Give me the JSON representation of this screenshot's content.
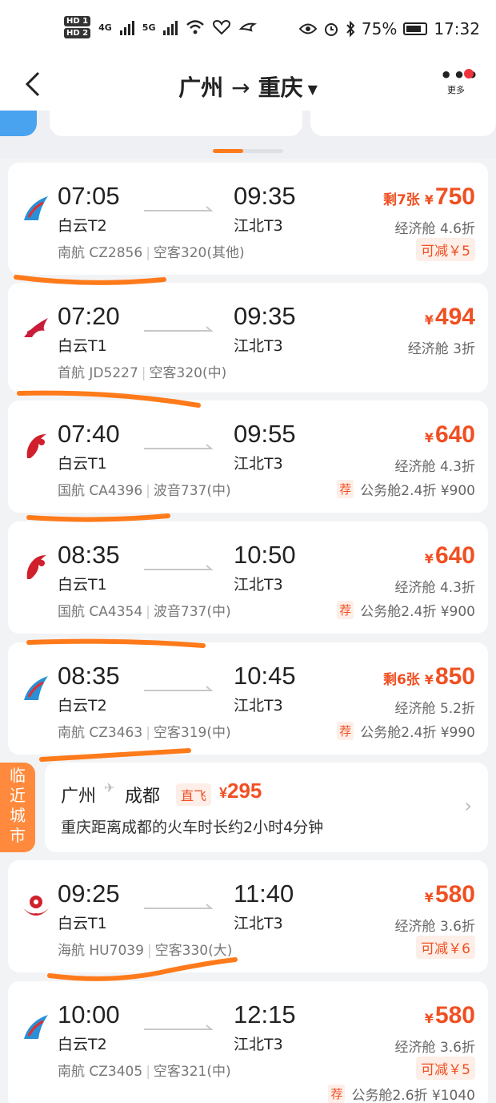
{
  "status_bar": {
    "hd1": "HD 1",
    "hd2": "HD 2",
    "net1": "4G",
    "net2": "5G",
    "battery": "75%",
    "time": "17:32"
  },
  "header": {
    "from": "广州",
    "arrow": "→",
    "to": "重庆",
    "more_label": "更多"
  },
  "flights": [
    {
      "airline_logo": "china-southern-logo",
      "dep_time": "07:05",
      "dep_airport": "白云T2",
      "arr_time": "09:35",
      "arr_airport": "江北T3",
      "airline": "南航 CZ2856",
      "aircraft": "空客320(其他)",
      "left_tickets": "剩7张",
      "currency": "¥",
      "price": "750",
      "cabin": "经济舱 4.6折",
      "discount": "可减￥5",
      "recommend_tag": "",
      "recommend": ""
    },
    {
      "airline_logo": "capital-airlines-logo",
      "dep_time": "07:20",
      "dep_airport": "白云T1",
      "arr_time": "09:35",
      "arr_airport": "江北T3",
      "airline": "首航 JD5227",
      "aircraft": "空客320(中)",
      "left_tickets": "",
      "currency": "¥",
      "price": "494",
      "cabin": "经济舱 3折",
      "discount": "",
      "recommend_tag": "",
      "recommend": ""
    },
    {
      "airline_logo": "air-china-logo",
      "dep_time": "07:40",
      "dep_airport": "白云T1",
      "arr_time": "09:55",
      "arr_airport": "江北T3",
      "airline": "国航 CA4396",
      "aircraft": "波音737(中)",
      "left_tickets": "",
      "currency": "¥",
      "price": "640",
      "cabin": "经济舱 4.3折",
      "discount": "",
      "recommend_tag": "荐",
      "recommend": "公务舱2.4折 ¥900"
    },
    {
      "airline_logo": "air-china-logo",
      "dep_time": "08:35",
      "dep_airport": "白云T1",
      "arr_time": "10:50",
      "arr_airport": "江北T3",
      "airline": "国航 CA4354",
      "aircraft": "波音737(中)",
      "left_tickets": "",
      "currency": "¥",
      "price": "640",
      "cabin": "经济舱 4.3折",
      "discount": "",
      "recommend_tag": "荐",
      "recommend": "公务舱2.4折 ¥900"
    },
    {
      "airline_logo": "china-southern-logo",
      "dep_time": "08:35",
      "dep_airport": "白云T2",
      "arr_time": "10:45",
      "arr_airport": "江北T3",
      "airline": "南航 CZ3463",
      "aircraft": "空客319(中)",
      "left_tickets": "剩6张",
      "currency": "¥",
      "price": "850",
      "cabin": "经济舱 5.2折",
      "discount": "",
      "recommend_tag": "荐",
      "recommend": "公务舱2.4折 ¥990"
    },
    {
      "airline_logo": "hainan-airlines-logo",
      "dep_time": "09:25",
      "dep_airport": "白云T1",
      "arr_time": "11:40",
      "arr_airport": "江北T3",
      "airline": "海航 HU7039",
      "aircraft": "空客330(大)",
      "left_tickets": "",
      "currency": "¥",
      "price": "580",
      "cabin": "经济舱 3.6折",
      "discount": "可减￥6",
      "recommend_tag": "",
      "recommend": ""
    },
    {
      "airline_logo": "china-southern-logo",
      "dep_time": "10:00",
      "dep_airport": "白云T2",
      "arr_time": "12:15",
      "arr_airport": "江北T3",
      "airline": "南航 CZ3405",
      "aircraft": "空客321(中)",
      "left_tickets": "",
      "currency": "¥",
      "price": "580",
      "cabin": "经济舱 3.6折",
      "discount": "可减￥5",
      "recommend_tag": "荐",
      "recommend": "公务舱2.6折 ¥1040"
    }
  ],
  "nearby_city": {
    "side_label": "临近城市",
    "from": "广州",
    "to": "成都",
    "direct": "直飞",
    "currency": "¥",
    "price": "295",
    "description": "重庆距离成都的火车时长约2小时4分钟"
  },
  "colors": {
    "price": "#f05022",
    "accent": "#ff7a1a",
    "annotation": "#ff7a1a"
  }
}
